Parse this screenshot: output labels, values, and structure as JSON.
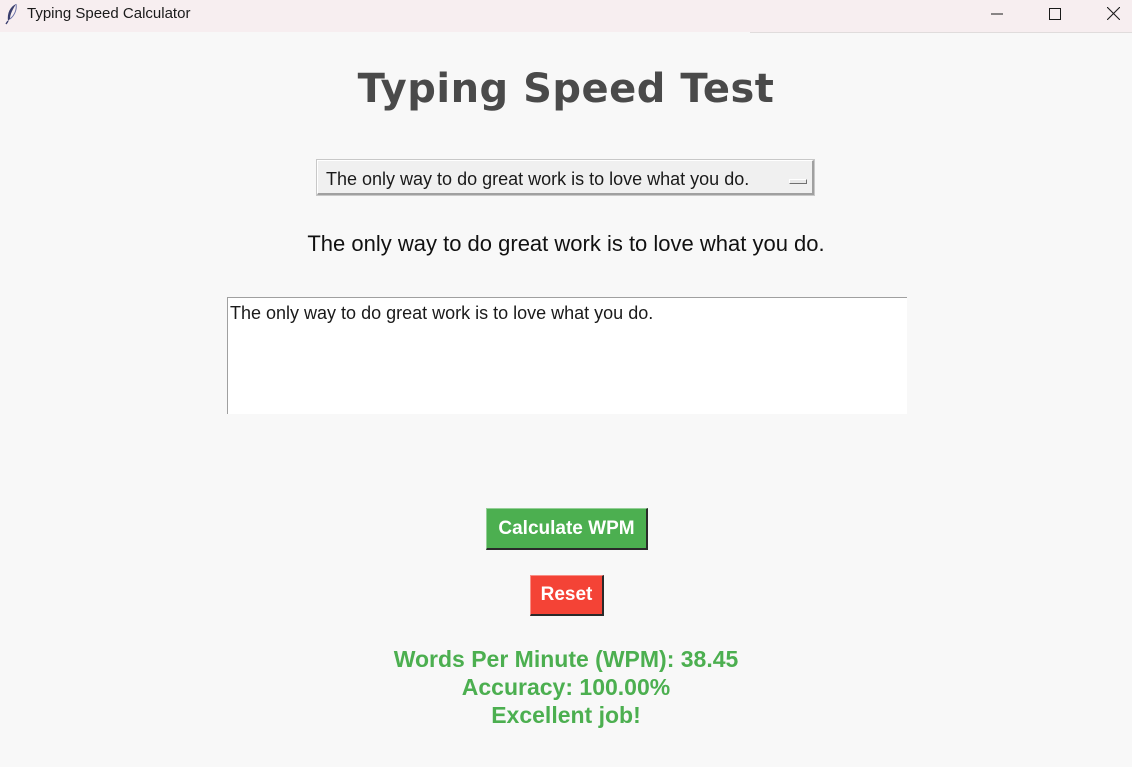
{
  "window": {
    "title": "Typing Speed Calculator",
    "icons": {
      "app": "feather-icon",
      "minimize": "minimize-icon",
      "maximize": "maximize-icon",
      "close": "close-icon"
    }
  },
  "main": {
    "heading": "Typing Speed Test",
    "sentence_dropdown": {
      "selected": "The only way to do great work is to love what you do.",
      "indicator": "option-menu-indicator"
    },
    "target_sentence": "The only way to do great work is to love what you do.",
    "typing_area": {
      "value": "The only way to do great work is to love what you do."
    },
    "buttons": {
      "calculate_label": "Calculate WPM",
      "reset_label": "Reset"
    },
    "results": {
      "wpm_text": "Words Per Minute (WPM): 38.45",
      "accuracy_text": "Accuracy: 100.00%",
      "feedback_text": "Excellent job!"
    }
  },
  "colors": {
    "background": "#f8f8f8",
    "titlebar": "#f7eef0",
    "heading": "#4a4a4a",
    "calculate_button": "#4caf50",
    "reset_button": "#f44336",
    "results_text": "#4caf50"
  }
}
